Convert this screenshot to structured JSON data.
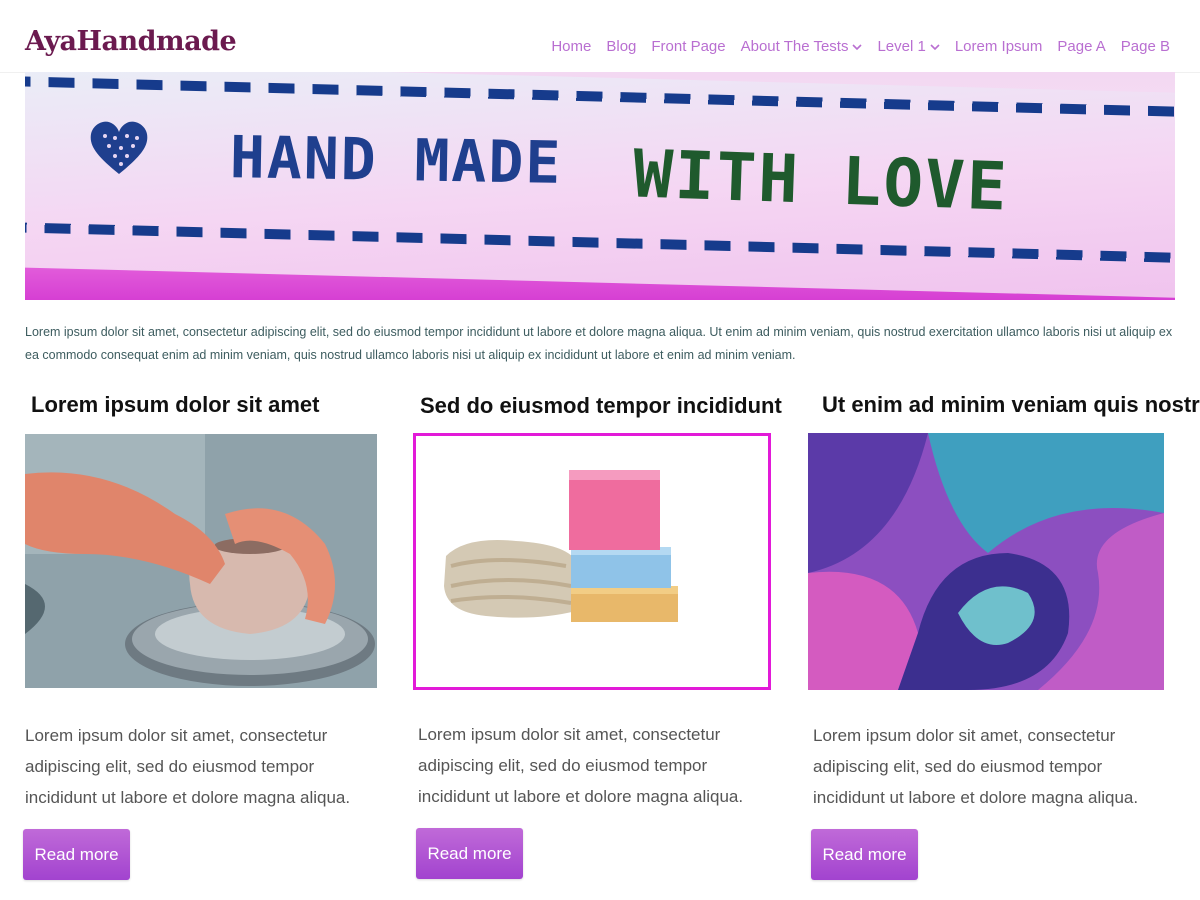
{
  "site": {
    "logo": "AyaHandmade"
  },
  "nav": [
    {
      "label": "Home"
    },
    {
      "label": "Blog"
    },
    {
      "label": "Front Page"
    },
    {
      "label": "About The Tests",
      "dropdown": true
    },
    {
      "label": "Level 1",
      "dropdown": true
    },
    {
      "label": "Lorem Ipsum"
    },
    {
      "label": "Page A"
    },
    {
      "label": "Page B"
    }
  ],
  "hero": {
    "text_left": "HAND MADE",
    "text_right": "WITH LOVE"
  },
  "intro": "Lorem ipsum dolor sit amet, consectetur adipiscing elit, sed do eiusmod tempor incididunt ut labore et dolore magna aliqua. Ut enim ad minim veniam, quis nostrud exercitation ullamco laboris nisi ut aliquip ex ea commodo consequat enim ad minim veniam, quis nostrud ullamco laboris nisi ut aliquip ex incididunt ut labore et enim ad minim veniam.",
  "cards": [
    {
      "title": "Lorem ipsum dolor sit amet",
      "description": "Lorem ipsum dolor sit amet, consectetur adipiscing elit, sed do eiusmod tempor incididunt ut labore et dolore magna aliqua.",
      "button": "Read more"
    },
    {
      "title": "Sed do eiusmod tempor incididunt",
      "description": "Lorem ipsum dolor sit amet, consectetur adipiscing elit, sed do eiusmod tempor incididunt ut labore et dolore magna aliqua.",
      "button": "Read more"
    },
    {
      "title": "Ut enim ad minim veniam quis nostrud",
      "description": "Lorem ipsum dolor sit amet, consectetur adipiscing elit, sed do eiusmod tempor incididunt ut labore et dolore magna aliqua.",
      "button": "Read more"
    }
  ],
  "colors": {
    "logo": "#6b1a4f",
    "nav_link": "#b96fd1",
    "button": "#a243cf",
    "selected_frame": "#e21ad8",
    "intro_text": "#3d5c5f"
  }
}
